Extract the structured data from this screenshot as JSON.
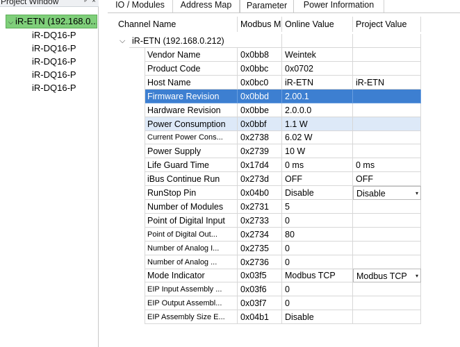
{
  "project_window": {
    "title": "Project Window",
    "pin_glyph": "ᵖ",
    "close_glyph": "×",
    "root": "iR-ETN (192.168.0...",
    "children": [
      "iR-DQ16-P",
      "iR-DQ16-P",
      "iR-DQ16-P",
      "iR-DQ16-P",
      "iR-DQ16-P"
    ]
  },
  "tabs": [
    {
      "label": "IO / Modules"
    },
    {
      "label": "Address Map"
    },
    {
      "label": "Parameter",
      "active": true
    },
    {
      "label": "Power Information"
    }
  ],
  "grid": {
    "columns": [
      "Channel Name",
      "Modbus Ma",
      "Online Value",
      "Project Value"
    ],
    "root_label": "iR-ETN (192.168.0.212)",
    "rows": [
      {
        "name": "Vendor Name",
        "addr": "0x0bb8",
        "online": "Weintek",
        "project": ""
      },
      {
        "name": "Product Code",
        "addr": "0x0bbc",
        "online": "0x0702",
        "project": ""
      },
      {
        "name": "Host Name",
        "addr": "0x0bc0",
        "online": "iR-ETN",
        "project": "iR-ETN"
      },
      {
        "name": "Firmware Revision",
        "addr": "0x0bbd",
        "online": "2.00.1",
        "project": ""
      },
      {
        "name": "Hardware Revision",
        "addr": "0x0bbe",
        "online": "2.0.0.0",
        "project": ""
      },
      {
        "name": "Power Consumption",
        "addr": "0x0bbf",
        "online": "1.1 W",
        "project": ""
      },
      {
        "name": "Current Power Cons...",
        "addr": "0x2738",
        "online": "6.02 W",
        "project": ""
      },
      {
        "name": "Power Supply",
        "addr": "0x2739",
        "online": "10 W",
        "project": ""
      },
      {
        "name": "Life Guard Time",
        "addr": "0x17d4",
        "online": "0 ms",
        "project": "0 ms"
      },
      {
        "name": "iBus Continue Run",
        "addr": "0x273d",
        "online": "OFF",
        "project": "OFF"
      },
      {
        "name": "RunStop Pin",
        "addr": "0x04b0",
        "online": "Disable",
        "project": "Disable"
      },
      {
        "name": "Number of Modules",
        "addr": "0x2731",
        "online": "5",
        "project": ""
      },
      {
        "name": "Point of Digital Input",
        "addr": "0x2733",
        "online": "0",
        "project": ""
      },
      {
        "name": "Point of Digital Out...",
        "addr": "0x2734",
        "online": "80",
        "project": ""
      },
      {
        "name": "Number of Analog I...",
        "addr": "0x2735",
        "online": "0",
        "project": ""
      },
      {
        "name": "Number of Analog ...",
        "addr": "0x2736",
        "online": "0",
        "project": ""
      },
      {
        "name": "Mode Indicator",
        "addr": "0x03f5",
        "online": "Modbus TCP",
        "project": "Modbus TCP"
      },
      {
        "name": "EIP Input Assembly ...",
        "addr": "0x03f6",
        "online": "0",
        "project": ""
      },
      {
        "name": "EIP Output Assembl...",
        "addr": "0x03f7",
        "online": "0",
        "project": ""
      },
      {
        "name": "EIP Assembly Size E...",
        "addr": "0x04b1",
        "online": "Disable",
        "project": ""
      }
    ]
  },
  "icons": {
    "expand": "chevron-down-icon",
    "dropdown": "dropdown-arrow-icon"
  },
  "colors": {
    "selected_row": "#3d7fd1",
    "hover_row": "#dde9f8",
    "tree_root": "#7fcf7a"
  }
}
